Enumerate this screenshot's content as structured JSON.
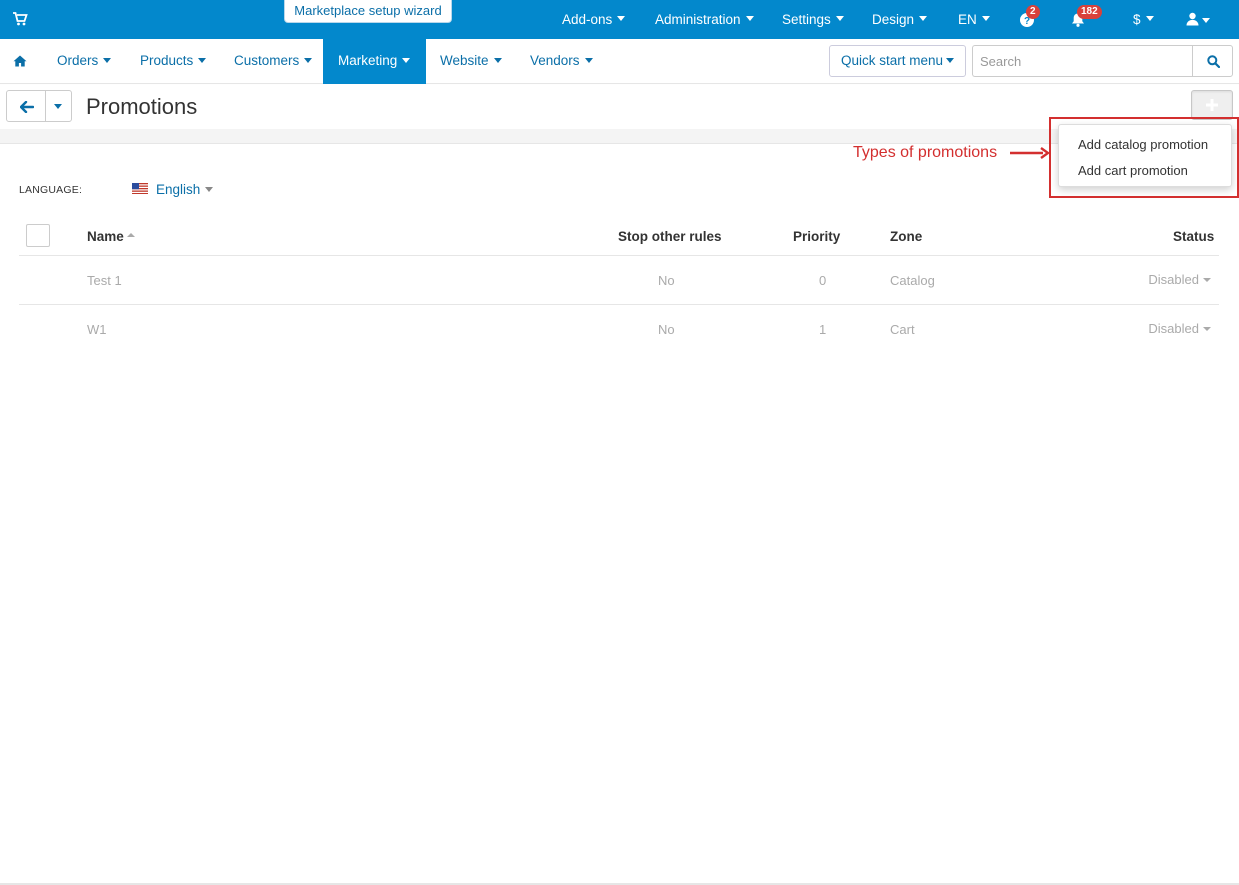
{
  "topbar": {
    "wizard_label": "Marketplace setup wizard",
    "menu": [
      "Add-ons",
      "Administration",
      "Settings",
      "Design",
      "EN"
    ],
    "help_badge": "2",
    "notifications_badge": "182",
    "currency": "$",
    "icons": [
      "cart-icon",
      "help-icon",
      "bell-icon",
      "user-icon"
    ]
  },
  "mainnav": {
    "items": [
      "Orders",
      "Products",
      "Customers",
      "Marketing",
      "Website",
      "Vendors"
    ],
    "active": "Marketing",
    "quick_start": "Quick start menu",
    "search_placeholder": "Search"
  },
  "page": {
    "title": "Promotions"
  },
  "dropdown": {
    "items": [
      "Add catalog promotion",
      "Add cart promotion"
    ]
  },
  "annotation": {
    "text": "Types of promotions"
  },
  "language": {
    "label": "LANGUAGE:",
    "value": "English"
  },
  "table": {
    "columns": [
      "Name",
      "Stop other rules",
      "Priority",
      "Zone",
      "Status"
    ],
    "rows": [
      {
        "name": "Test 1",
        "stop_other_rules": "No",
        "priority": "0",
        "zone": "Catalog",
        "status": "Disabled"
      },
      {
        "name": "W1",
        "stop_other_rules": "No",
        "priority": "1",
        "zone": "Cart",
        "status": "Disabled"
      }
    ]
  },
  "colors": {
    "primary": "#0388cc",
    "link": "#0b6fa8",
    "badge": "#d9413b",
    "annotation": "#d32f2f"
  }
}
